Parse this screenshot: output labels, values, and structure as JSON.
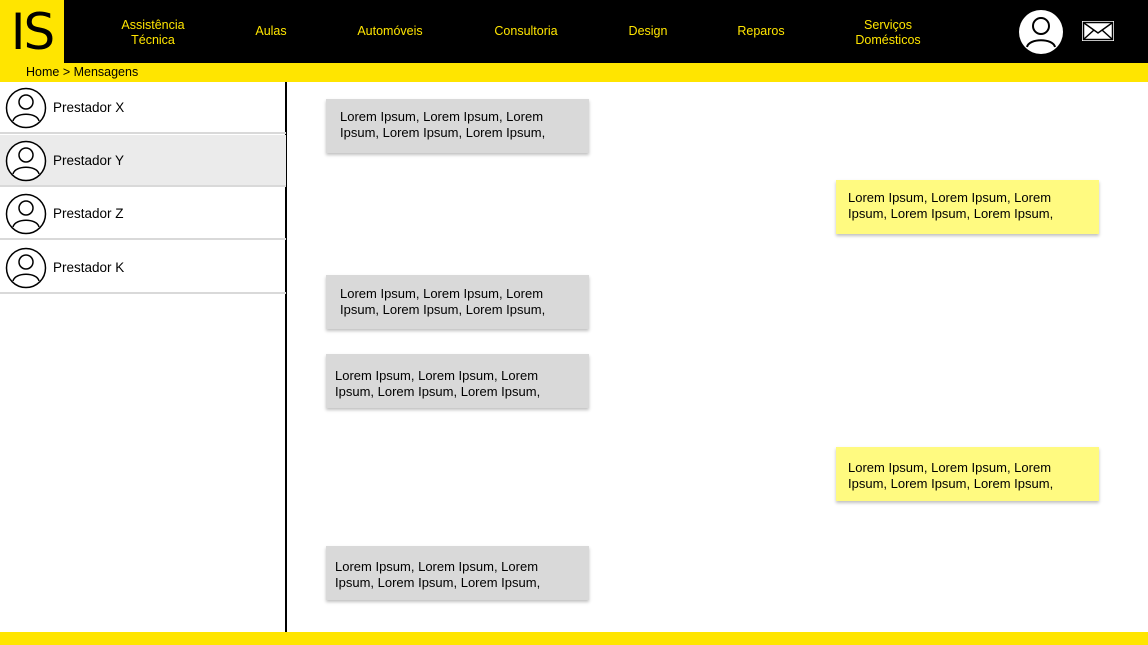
{
  "logo": {
    "text": "IS"
  },
  "nav": {
    "items": [
      {
        "line1": "Assistência",
        "line2": "Técnica"
      },
      {
        "line1": "Aulas",
        "line2": ""
      },
      {
        "line1": "Automóveis",
        "line2": ""
      },
      {
        "line1": "Consultoria",
        "line2": ""
      },
      {
        "line1": "Design",
        "line2": ""
      },
      {
        "line1": "Reparos",
        "line2": ""
      },
      {
        "line1": "Serviços",
        "line2": "Domésticos"
      }
    ]
  },
  "header_icons": {
    "profile": "user-icon",
    "messages": "mail-icon"
  },
  "breadcrumb": {
    "text": "Home > Mensagens"
  },
  "contacts": [
    {
      "name": "Prestador X",
      "active": false
    },
    {
      "name": "Prestador Y",
      "active": true
    },
    {
      "name": "Prestador Z",
      "active": false
    },
    {
      "name": "Prestador K",
      "active": false
    }
  ],
  "messages": [
    {
      "type": "received",
      "line1": "Lorem Ipsum, Lorem Ipsum, Lorem",
      "line2": "Ipsum, Lorem Ipsum, Lorem Ipsum,"
    },
    {
      "type": "sent",
      "line1": "Lorem Ipsum, Lorem Ipsum, Lorem",
      "line2": "Ipsum, Lorem Ipsum, Lorem Ipsum,"
    },
    {
      "type": "received",
      "line1": "Lorem Ipsum, Lorem Ipsum, Lorem",
      "line2": "Ipsum, Lorem Ipsum, Lorem Ipsum,"
    },
    {
      "type": "received",
      "line1": "Lorem Ipsum, Lorem Ipsum, Lorem",
      "line2": "Ipsum, Lorem Ipsum, Lorem Ipsum,"
    },
    {
      "type": "sent",
      "line1": "Lorem Ipsum, Lorem Ipsum, Lorem",
      "line2": "Ipsum, Lorem Ipsum, Lorem Ipsum,"
    },
    {
      "type": "received",
      "line1": "Lorem Ipsum, Lorem Ipsum, Lorem",
      "line2": "Ipsum, Lorem Ipsum, Lorem Ipsum,"
    }
  ],
  "colors": {
    "accent": "#FFE500",
    "header_bg": "#000000",
    "received_bubble": "#D9D9D9",
    "sent_bubble": "#FFFA80",
    "active_contact": "#EBEBEB"
  }
}
